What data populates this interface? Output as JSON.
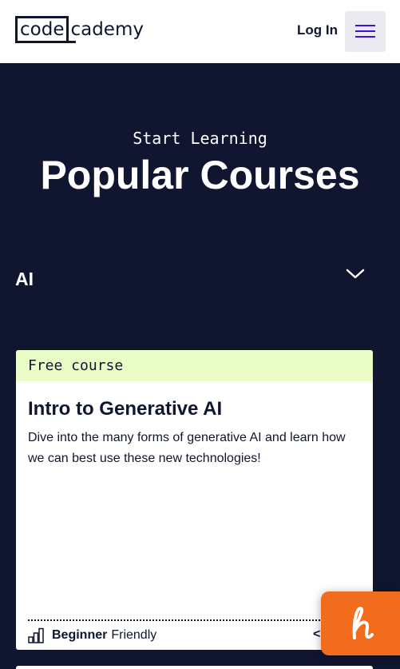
{
  "header": {
    "logo": {
      "part1": "code",
      "part2": "cademy"
    },
    "login_label": "Log In",
    "menu_icon": "hamburger-menu-icon"
  },
  "hero": {
    "eyebrow": "Start Learning",
    "title": "Popular Courses"
  },
  "category": {
    "selected": "AI",
    "icon": "chevron-down-icon"
  },
  "course_card": {
    "tag": "Free course",
    "title": "Intro to Generative AI",
    "description": "Dive into the many forms of generative AI and learn how we can best use these new technologies!",
    "level_strong": "Beginner",
    "level_rest": "Friendly",
    "level_icon": "bar-chart-icon",
    "trailing_text": "<"
  },
  "widget": {
    "icon": "honey-h-logo-icon",
    "color": "#f26c1d"
  },
  "colors": {
    "navy": "#10162f",
    "accent": "#3a10e5",
    "tag_bg": "#eafdc6"
  }
}
